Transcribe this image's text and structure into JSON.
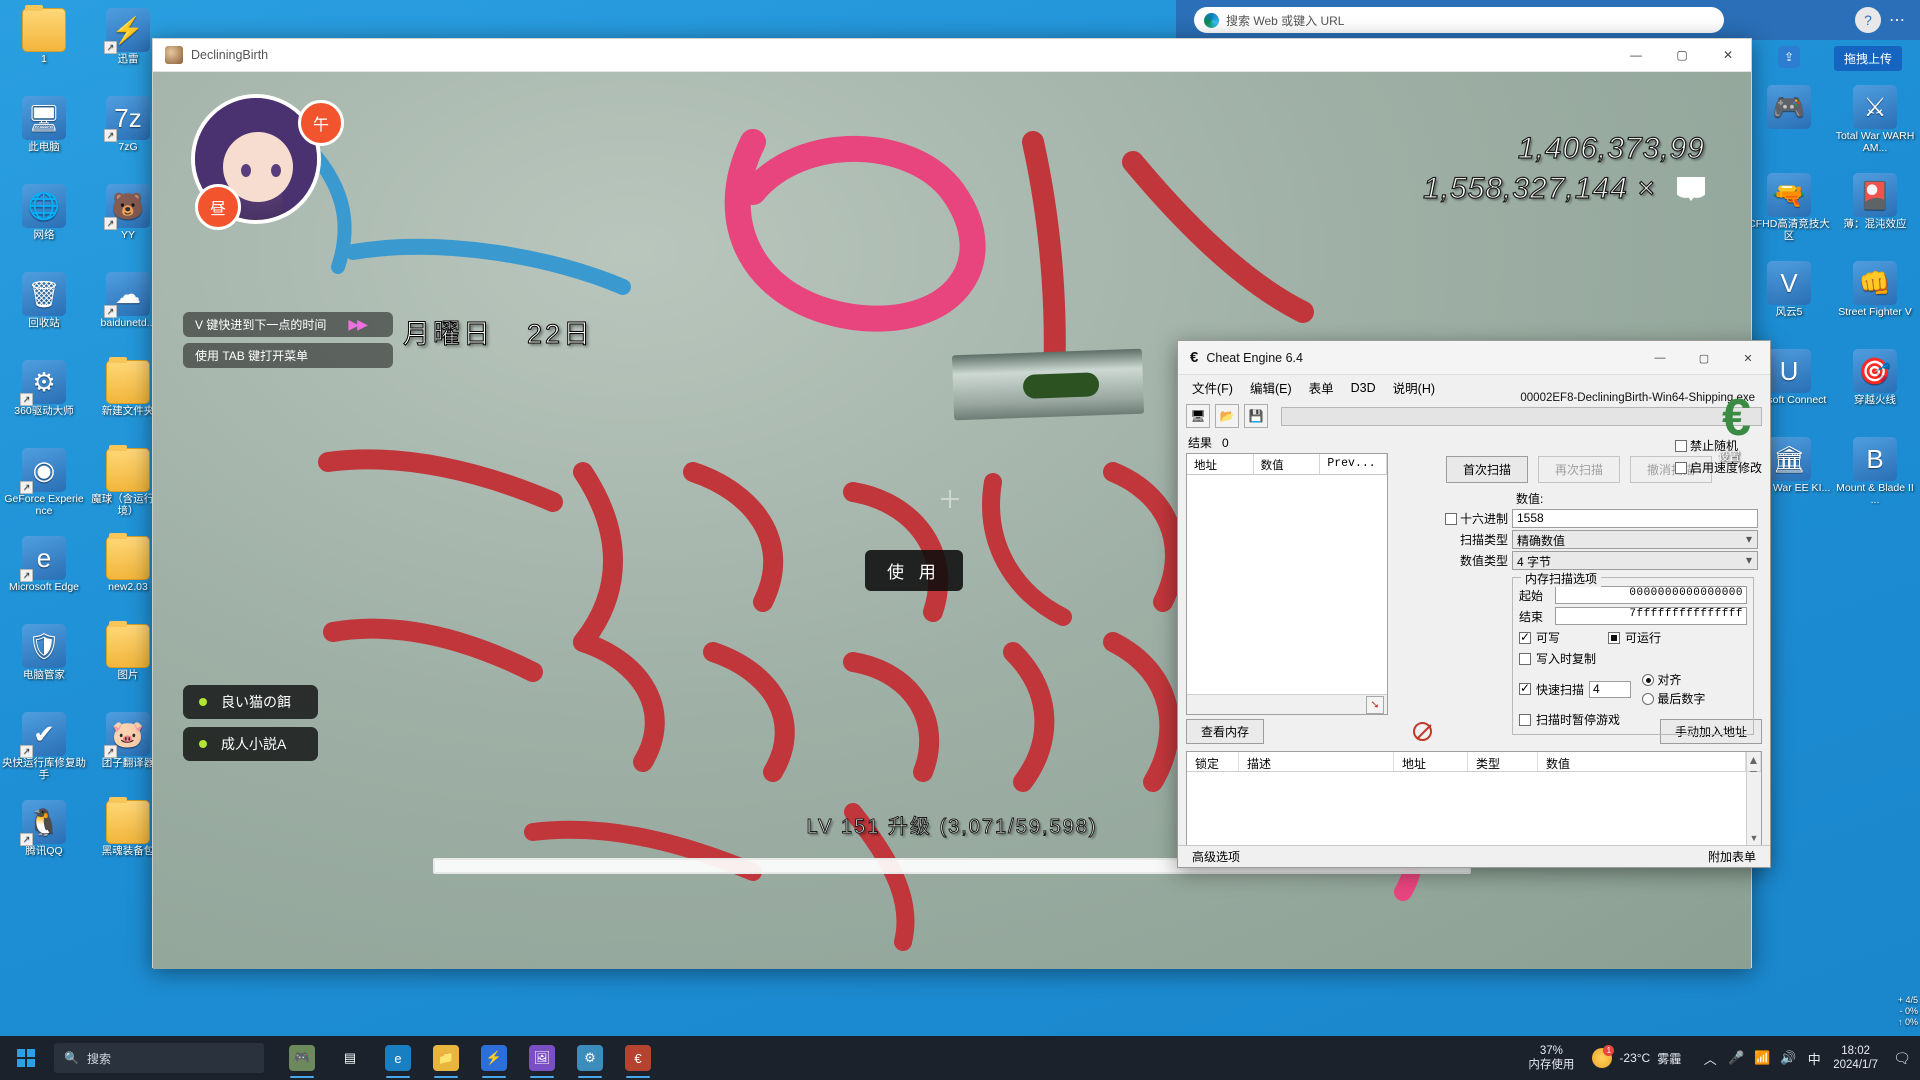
{
  "desktop": {
    "icons_col1": [
      {
        "label": "1",
        "glyph": "📁",
        "type": "folder",
        "shortcut": false
      },
      {
        "label": "此电脑",
        "glyph": "🖥",
        "type": "app",
        "shortcut": false
      },
      {
        "label": "网络",
        "glyph": "🌐",
        "type": "app",
        "shortcut": false
      },
      {
        "label": "回收站",
        "glyph": "🗑",
        "type": "app",
        "shortcut": false
      },
      {
        "label": "360驱动大师",
        "glyph": "⚙",
        "type": "app",
        "shortcut": true
      },
      {
        "label": "GeForce Experience",
        "glyph": "◉",
        "type": "app",
        "shortcut": true
      },
      {
        "label": "Microsoft Edge",
        "glyph": "e",
        "type": "app",
        "shortcut": true
      },
      {
        "label": "电脑管家",
        "glyph": "🛡",
        "type": "app",
        "shortcut": false
      },
      {
        "label": "央快运行库修复助手",
        "glyph": "✔",
        "type": "app",
        "shortcut": true
      },
      {
        "label": "腾讯QQ",
        "glyph": "🐧",
        "type": "app",
        "shortcut": true
      }
    ],
    "icons_col2": [
      {
        "label": "迅雷",
        "glyph": "⚡",
        "type": "app",
        "shortcut": true
      },
      {
        "label": "7zG",
        "glyph": "7z",
        "type": "app",
        "shortcut": true
      },
      {
        "label": "YY",
        "glyph": "🐻",
        "type": "app",
        "shortcut": true
      },
      {
        "label": "baidunetd...",
        "glyph": "☁",
        "type": "app",
        "shortcut": true
      },
      {
        "label": "新建文件夹",
        "glyph": "📁",
        "type": "folder",
        "shortcut": false
      },
      {
        "label": "魔球（含运行环境）",
        "glyph": "📁",
        "type": "folder",
        "shortcut": false
      },
      {
        "label": "new2.03",
        "glyph": "📁",
        "type": "folder",
        "shortcut": false
      },
      {
        "label": "图片",
        "glyph": "📁",
        "type": "folder",
        "shortcut": false
      },
      {
        "label": "团子翻译器",
        "glyph": "🐷",
        "type": "app",
        "shortcut": true
      },
      {
        "label": "黑魂装备包",
        "glyph": "📁",
        "type": "folder",
        "shortcut": false
      }
    ],
    "icons_right": [
      {
        "label": "",
        "glyph": "🎮",
        "type": "app"
      },
      {
        "label": "Total War WARHAM...",
        "glyph": "⚔",
        "type": "app"
      },
      {
        "label": "CFHD高清竞技大区",
        "glyph": "🔫",
        "type": "app"
      },
      {
        "label": "薄：混沌效应",
        "glyph": "🎴",
        "type": "app"
      },
      {
        "label": "风云5",
        "glyph": "V",
        "type": "app"
      },
      {
        "label": "Street Fighter V",
        "glyph": "👊",
        "type": "app"
      },
      {
        "label": "Ubisoft Connect",
        "glyph": "U",
        "type": "app"
      },
      {
        "label": "穿越火线",
        "glyph": "🎯",
        "type": "app"
      },
      {
        "label": "Total War EE KI...",
        "glyph": "🏛",
        "type": "app"
      },
      {
        "label": "Mount & Blade II ...",
        "glyph": "B",
        "type": "app"
      }
    ]
  },
  "browser": {
    "url_placeholder": "搜索 Web 或键入 URL",
    "help_icon": "?",
    "menu_icon": "⋯",
    "upload_label": "拖拽上传",
    "upload_icon": "upload-icon"
  },
  "game_window": {
    "title": "DecliningBirth",
    "minimize": "—",
    "maximize": "▢",
    "close": "✕",
    "hud": {
      "weekday": "月曜日",
      "day": "22日",
      "badge_day": "午",
      "badge_noon": "昼",
      "hint1": "V 键快进到下一点的时间",
      "hint1_icon": "fast-forward-icon",
      "hint2": "使用 TAB 键打开菜单",
      "counter_top": "1,406,373,99",
      "counter_bottom": "1,558,327,144 ×",
      "counter_heart_icon": "heart-icon",
      "quests": [
        "良い猫の餌",
        "成人小説A"
      ],
      "level_text": "LV 151  升级 (3,071/59,598)",
      "use_prompt": "使 用"
    }
  },
  "cheat_engine": {
    "title": "Cheat Engine 6.4",
    "icon": "cheat-engine-icon",
    "minimize": "—",
    "maximize": "▢",
    "close": "✕",
    "menu": [
      "文件(F)",
      "编辑(E)",
      "表单",
      "D3D",
      "说明(H)"
    ],
    "toolbar_icons": [
      "process-select-icon",
      "open-folder-icon",
      "save-icon"
    ],
    "process_name": "00002EF8-DecliningBirth-Win64-Shipping.exe",
    "result_label": "结果",
    "result_count": "0",
    "result_columns": [
      "地址",
      "数值",
      "Prev..."
    ],
    "scan_buttons": {
      "first_scan": "首次扫描",
      "next_scan": "再次扫描",
      "undo_scan": "撤消扫描"
    },
    "value_label": "数值:",
    "hex_checkbox": "十六进制",
    "hex_checked": false,
    "value": "1558",
    "scan_type_label": "扫描类型",
    "scan_type_value": "精确数值",
    "value_type_label": "数值类型",
    "value_type_value": "4 字节",
    "memory_options": {
      "group_label": "内存扫描选项",
      "start_label": "起始",
      "start_value": "0000000000000000",
      "end_label": "结束",
      "end_value": "7fffffffffffffff",
      "writable_label": "可写",
      "writable_checked": true,
      "executable_label": "可运行",
      "executable_checked": true,
      "copyonwrite_label": "写入时复制",
      "copyonwrite_checked": false,
      "fastscan_label": "快速扫描",
      "fastscan_checked": true,
      "fastscan_value": "4",
      "align_label": "对齐",
      "align_checked": true,
      "lastdigits_label": "最后数字",
      "lastdigits_checked": false,
      "pause_label": "扫描时暂停游戏",
      "pause_checked": false
    },
    "extra_options": {
      "no_random_label": "禁止随机",
      "no_random_checked": false,
      "speedhack_label": "启用速度修改",
      "speedhack_checked": false
    },
    "mid_buttons": {
      "view_memory": "查看内存",
      "add_address": "手动加入地址",
      "stop_icon": "stop-icon"
    },
    "address_list_columns": [
      "锁定",
      "描述",
      "地址",
      "类型",
      "数值"
    ],
    "status_left": "高级选项",
    "status_right": "附加表单",
    "logo_label": "设置",
    "logo_glyph": "€"
  },
  "taskbar": {
    "search_placeholder": "搜索",
    "search_icon": "search-icon",
    "start_icon": "windows-icon",
    "items": [
      {
        "name": "game-thumbnail",
        "glyph": "🎮",
        "color": "#6c8a5b",
        "active": true
      },
      {
        "name": "task-view",
        "glyph": "▤",
        "color": "transparent",
        "active": false
      },
      {
        "name": "edge",
        "glyph": "e",
        "color": "#1a7fc1",
        "active": true
      },
      {
        "name": "file-explorer",
        "glyph": "📁",
        "color": "#e8b53f",
        "active": true
      },
      {
        "name": "xunlei",
        "glyph": "⚡",
        "color": "#2d6fd8",
        "active": true
      },
      {
        "name": "photo-viewer",
        "glyph": "🖼",
        "color": "#7b4fc4",
        "active": true
      },
      {
        "name": "settings-app",
        "glyph": "⚙",
        "color": "#3c8dbc",
        "active": true
      },
      {
        "name": "cheat-engine",
        "glyph": "€",
        "color": "#b5432f",
        "active": true
      }
    ],
    "memory_percent": "37%",
    "memory_label": "内存使用",
    "temperature": "-23°C",
    "weather": "雾霾",
    "weather_badge": "1",
    "tray_icons": [
      "chevron-up-icon",
      "microphone-icon",
      "wifi-icon",
      "volume-icon",
      "ime-icon"
    ],
    "ime": "中",
    "time": "18:02",
    "date": "2024/1/7",
    "notification_icon": "notification-icon",
    "side_stats": "+ 4/5\n- 0%\n↑ 0%"
  }
}
